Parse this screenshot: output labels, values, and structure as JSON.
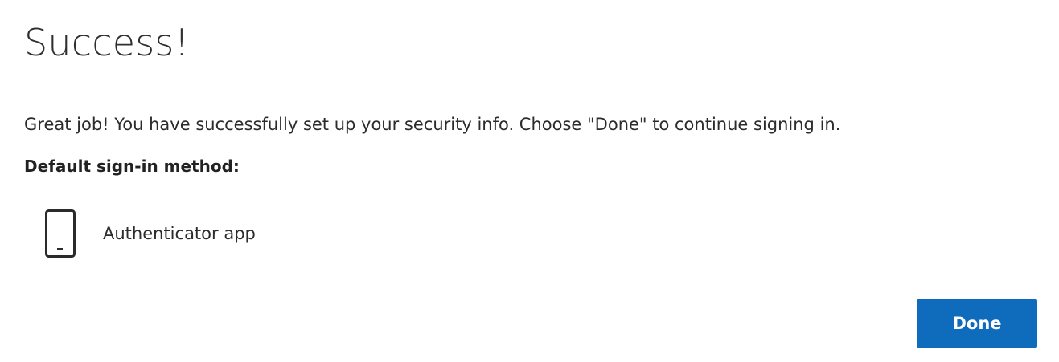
{
  "page": {
    "title": "Success!",
    "message": "Great job! You have successfully set up your security info. Choose \"Done\" to continue signing in.",
    "default_method_heading": "Default sign-in method:"
  },
  "method": {
    "icon": "phone-icon",
    "label": "Authenticator app"
  },
  "actions": {
    "done_label": "Done"
  },
  "colors": {
    "accent": "#0f6cbd",
    "text": "#2b2b2b",
    "background": "#ffffff"
  }
}
